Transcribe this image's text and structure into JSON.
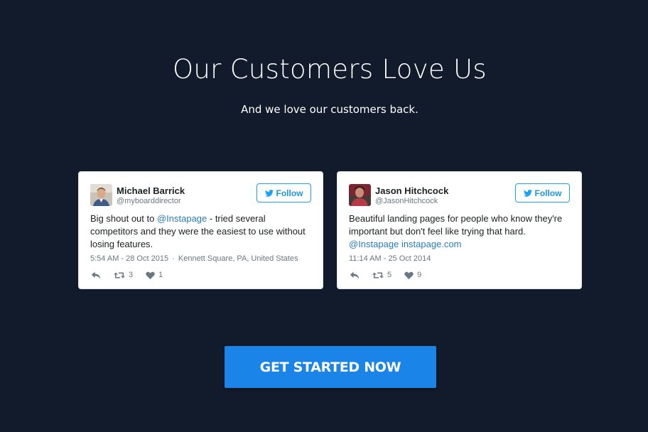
{
  "section": {
    "title": "Our Customers Love Us",
    "subtitle": "And we love our customers back."
  },
  "tweets": [
    {
      "name": "Michael Barrick",
      "handle": "@myboarddirector",
      "follow_label": "Follow",
      "text_before": "Big shout out to ",
      "mention": "@Instapage",
      "text_after": " - tried several competitors and they were the easiest to use without losing features.",
      "time": "5:54 AM - 28 Oct 2015",
      "separator": "·",
      "location": "Kennett Square, PA, United States",
      "retweets": "3",
      "likes": "1"
    },
    {
      "name": "Jason Hitchcock",
      "handle": "@JasonHitchcock",
      "follow_label": "Follow",
      "text": "Beautiful landing pages for people who know they're important but don't feel like trying that hard.",
      "mention": "@Instapage",
      "url": "instapage.com",
      "time": "11:14 AM - 25 Oct 2014",
      "retweets": "5",
      "likes": "9"
    }
  ],
  "cta": {
    "label": "GET STARTED NOW"
  },
  "icons": {
    "follow": "twitter-bird-icon",
    "reply": "reply-icon",
    "retweet": "retweet-icon",
    "like": "heart-icon"
  },
  "colors": {
    "background": "#111b2b",
    "card": "#ffffff",
    "twitter_blue": "#1da1f2",
    "link": "#2b7bb9",
    "cta": "#1a84e8"
  }
}
